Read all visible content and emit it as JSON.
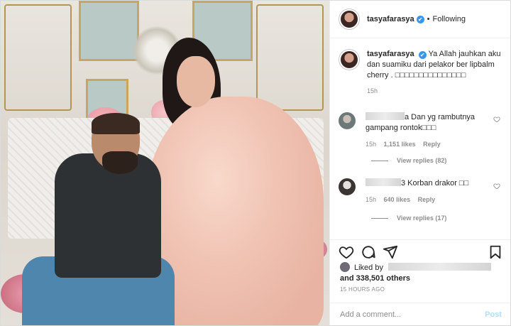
{
  "post": {
    "username": "tasyafarasya",
    "follow_state": "Following",
    "separator": "•",
    "verified_mark": "✔"
  },
  "caption": {
    "username": "tasyafarasya",
    "text": "Ya Allah jauhkan aku dan suamiku dari pelakor ber lipbalm cherry . □□□□□□□□□□□□□□□",
    "time": "15h"
  },
  "comments": [
    {
      "text_tail": "a Dan yg rambutnya gampang rontok□□□",
      "time": "15h",
      "likes": "1,151 likes",
      "reply_label": "Reply",
      "view_replies": "View replies (82)"
    },
    {
      "text_prefix": "rntuuu",
      "text_tail": "3 Korban drakor □□",
      "time": "15h",
      "likes": "640 likes",
      "reply_label": "Reply",
      "view_replies": "View replies (17)"
    }
  ],
  "likes": {
    "prefix": "Liked by",
    "and_text": "and 338,501 others"
  },
  "timestamp": "15 HOURS AGO",
  "comment_box": {
    "placeholder": "Add a comment...",
    "post_label": "Post"
  },
  "icons": [
    "heart-icon",
    "comment-icon",
    "share-icon",
    "bookmark-icon",
    "verified-icon"
  ],
  "colors": {
    "verified": "#3897f0",
    "post_disabled": "#b2dffc",
    "muted": "#8e8e8e"
  }
}
